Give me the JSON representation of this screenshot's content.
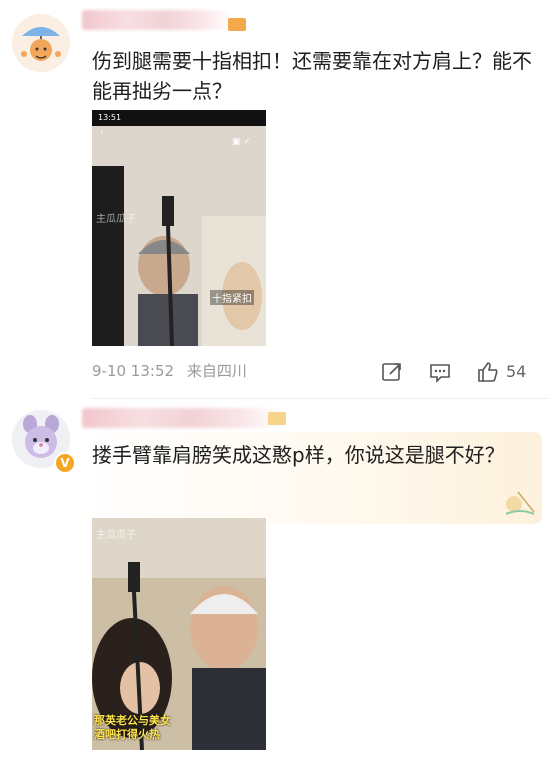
{
  "comment1": {
    "text": "伤到腿需要十指相扣！还需要靠在对方肩上？能不能再拙劣一点？",
    "time": "9-10 13:52",
    "location": "来自四川",
    "likes": "54",
    "image": {
      "status_time": "13:51",
      "watermark": "主瓜瓜子",
      "caption": "十指紧扣"
    }
  },
  "comment2": {
    "text": "搂手臂靠肩膀笑成这憨p样，你说这是腿不好？",
    "image": {
      "watermark": "主瓜瓜子",
      "caption_line1": "那英老公与美女",
      "caption_line2": "酒吧打得火热"
    }
  },
  "colors": {
    "accent_orange": "#f5a623",
    "meta_gray": "#9a9a9a"
  },
  "icons": [
    "share-icon",
    "comment-icon",
    "like-icon",
    "verified-icon"
  ]
}
